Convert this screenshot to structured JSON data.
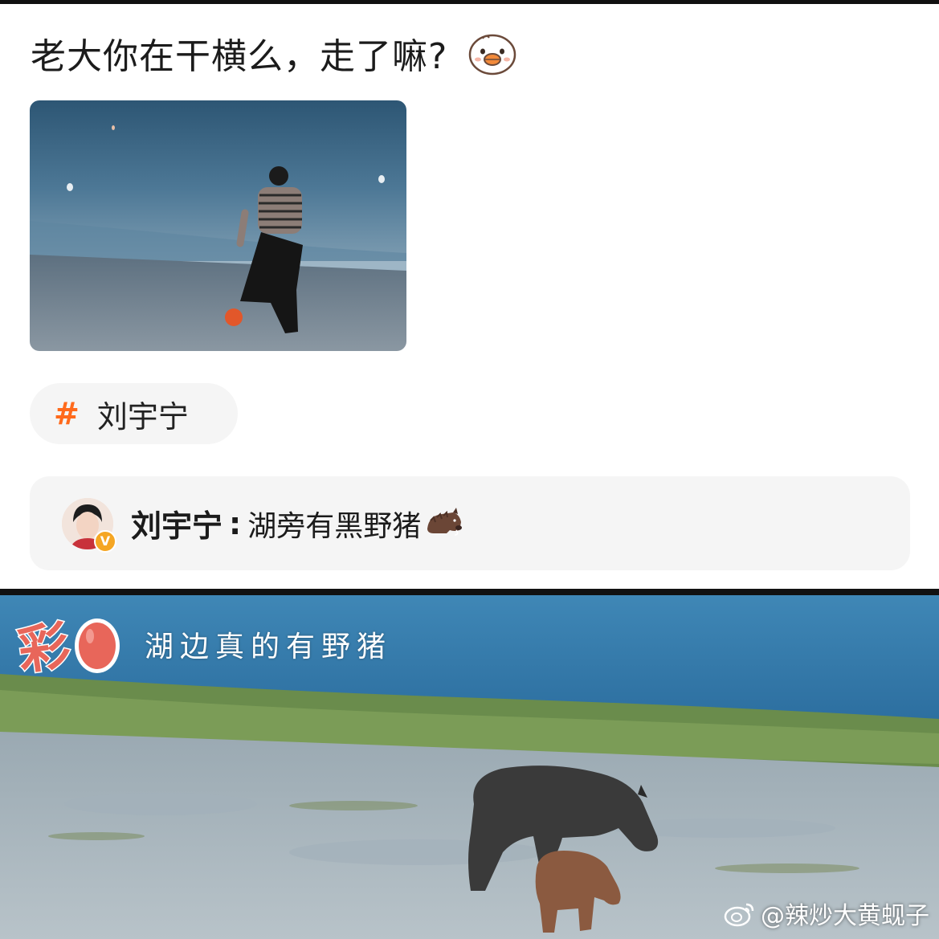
{
  "post": {
    "text": "老大你在干横么，走了嘛?",
    "emoji_icon": "duck-face-icon"
  },
  "topic": {
    "hash_symbol": "#",
    "label": "刘宇宁"
  },
  "comment": {
    "author": "刘宇宁",
    "separator": ":",
    "text": "湖旁有黑野猪",
    "emoji_icon": "boar-icon",
    "verified_icon": "verified-v-icon",
    "verified_symbol": "V"
  },
  "video_caption": {
    "title_char": "彩",
    "egg_icon": "egg-icon",
    "text": "湖边真的有野猪"
  },
  "watermark": {
    "text": "@辣炒大黄蚬子",
    "icon": "weibo-icon"
  },
  "colors": {
    "accent": "#ff6a1c",
    "badge": "#f5a623",
    "chip_bg": "#f5f5f5",
    "egg": "#e8665a"
  }
}
